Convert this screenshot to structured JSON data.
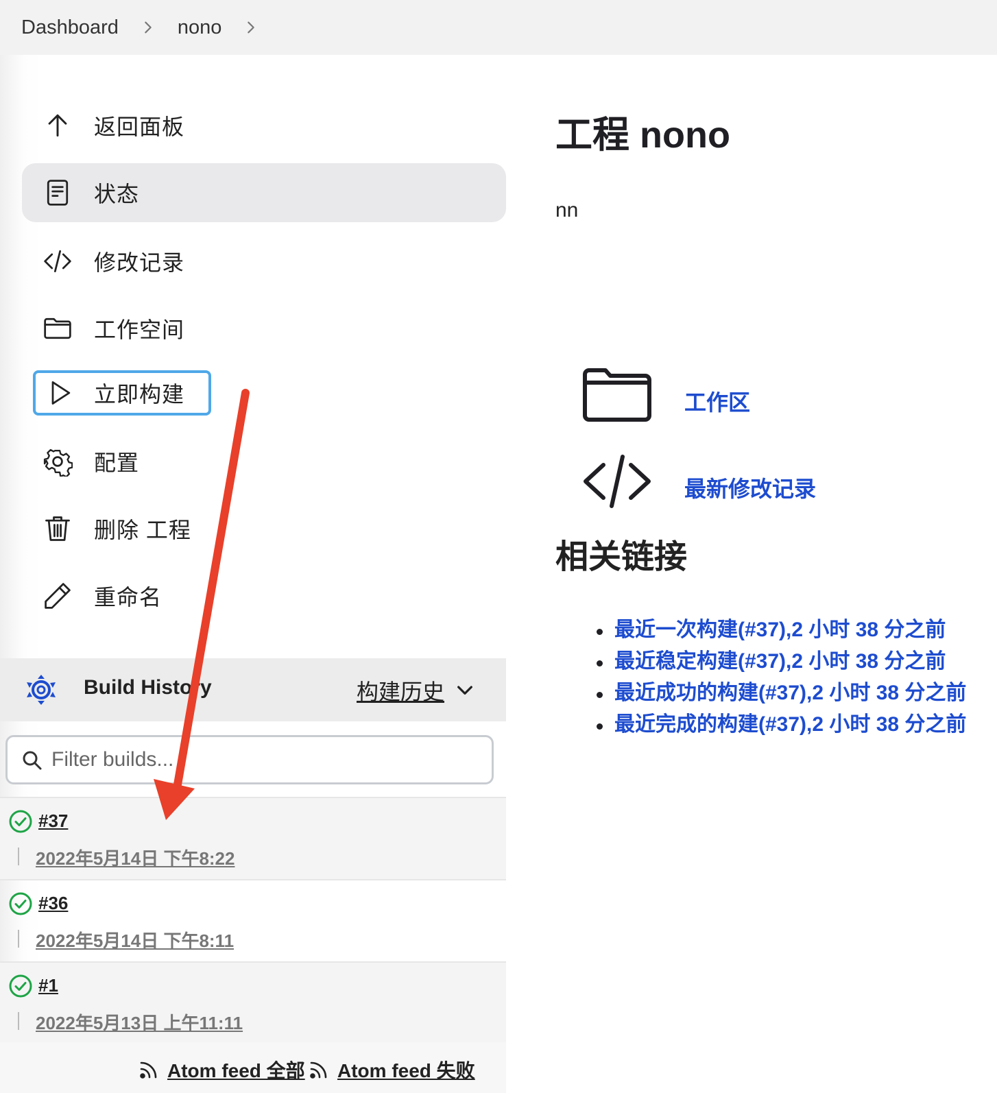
{
  "breadcrumb": {
    "items": [
      "Dashboard",
      "nono"
    ]
  },
  "sidebar": {
    "tasks": [
      {
        "label": "返回面板",
        "icon": "arrow-up-icon"
      },
      {
        "label": "状态",
        "icon": "document-icon"
      },
      {
        "label": "修改记录",
        "icon": "code-icon"
      },
      {
        "label": "工作空间",
        "icon": "folder-icon"
      },
      {
        "label": "立即构建",
        "icon": "play-icon"
      },
      {
        "label": "配置",
        "icon": "gear-icon"
      },
      {
        "label": "删除 工程",
        "icon": "trash-icon"
      },
      {
        "label": "重命名",
        "icon": "pencil-icon"
      }
    ]
  },
  "build_history": {
    "title": "Build History",
    "trend_link": "构建历史",
    "filter_placeholder": "Filter builds...",
    "builds": [
      {
        "number": "#37",
        "time": "2022年5月14日 下午8:22",
        "status": "success"
      },
      {
        "number": "#36",
        "time": "2022年5月14日 下午8:11",
        "status": "success"
      },
      {
        "number": "#1",
        "time": "2022年5月13日 上午11:11",
        "status": "success"
      }
    ],
    "feeds": [
      "Atom feed 全部",
      "Atom feed 失败"
    ]
  },
  "main": {
    "title": "工程 nono",
    "description": "nn",
    "links": [
      {
        "label": "工作区",
        "icon": "folder-icon"
      },
      {
        "label": "最新修改记录",
        "icon": "code-icon"
      }
    ],
    "related_title": "相关链接",
    "related_links": [
      "最近一次构建(#37),2 小时 38 分之前",
      "最近稳定构建(#37),2 小时 38 分之前",
      "最近成功的构建(#37),2 小时 38 分之前",
      "最近完成的构建(#37),2 小时 38 分之前"
    ]
  },
  "colors": {
    "link": "#1d4ccf",
    "active_task_bg": "#e9e9eb",
    "focus_ring": "#4fa8e8",
    "success": "#1ea446",
    "annotation_arrow": "#e8402a"
  }
}
